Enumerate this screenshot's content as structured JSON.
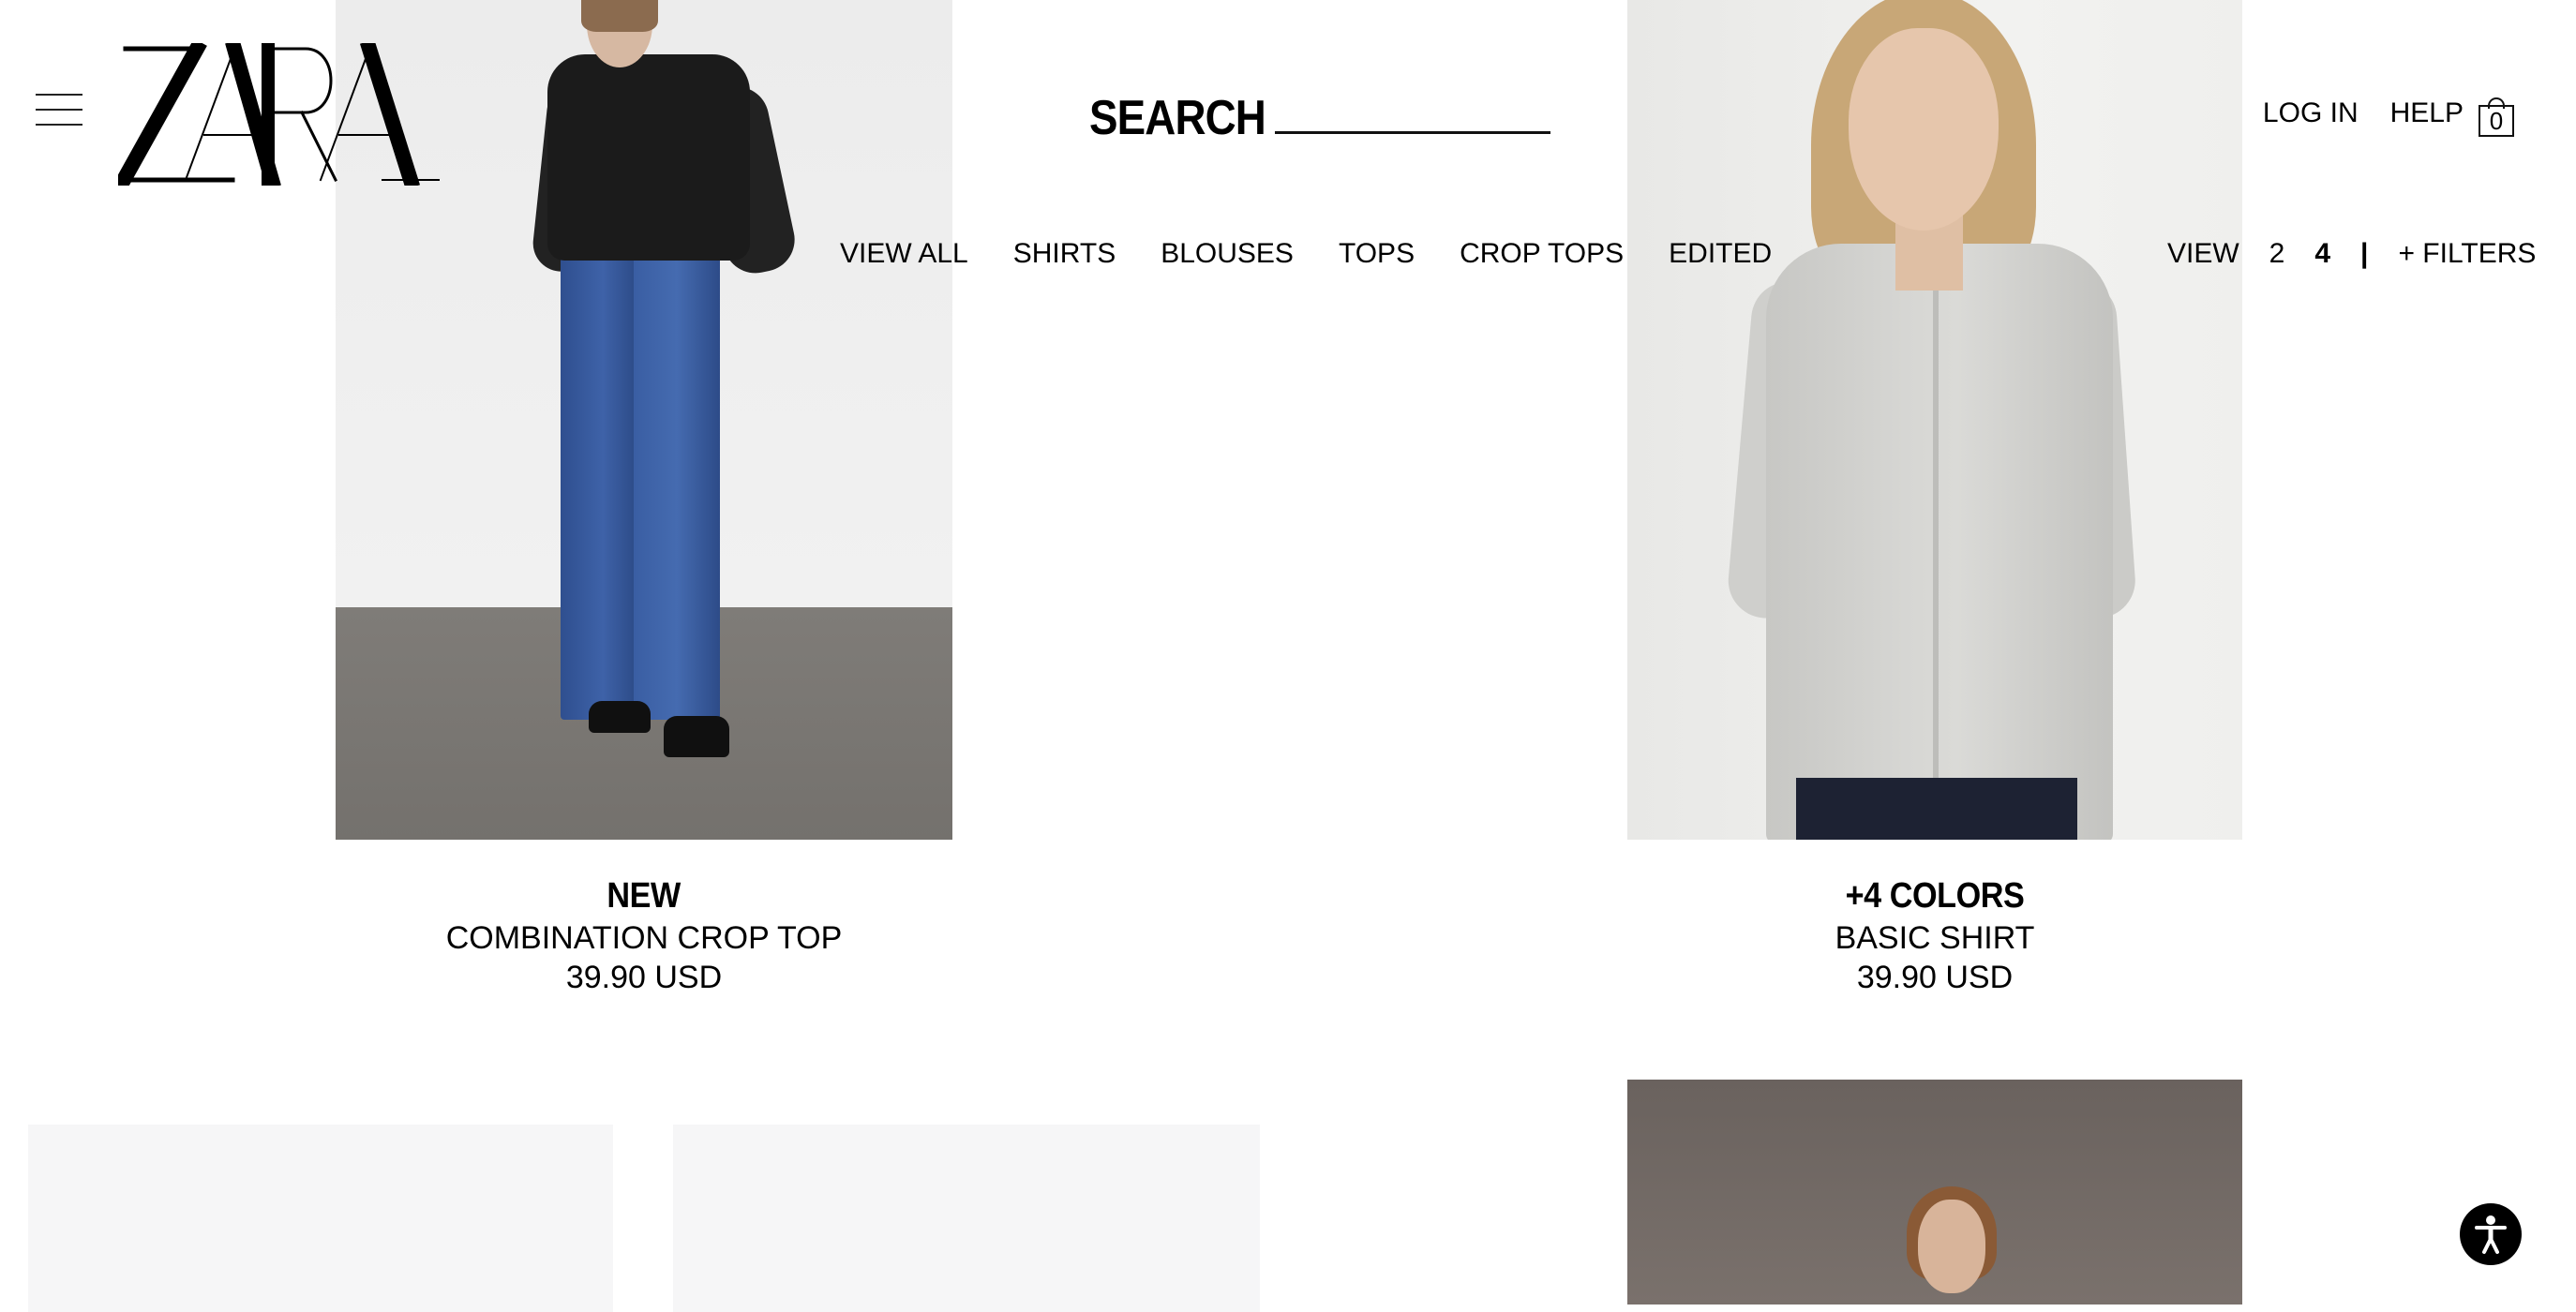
{
  "header": {
    "brand": "ZARA",
    "search_label": "SEARCH",
    "links": {
      "login": "LOG IN",
      "help": "HELP"
    },
    "cart_count": "0"
  },
  "categories": [
    "VIEW ALL",
    "SHIRTS",
    "BLOUSES",
    "TOPS",
    "CROP TOPS",
    "EDITED"
  ],
  "view_controls": {
    "label": "VIEW",
    "options": [
      "2",
      "4"
    ],
    "active": "4",
    "separator": "|",
    "filters": "+ FILTERS"
  },
  "products": [
    {
      "tag": "NEW",
      "name": "COMBINATION CROP TOP",
      "price": "39.90 USD"
    },
    {
      "tag": "+4 COLORS",
      "name": "BASIC SHIRT",
      "price": "39.90 USD"
    }
  ],
  "icons": {
    "menu": "hamburger-icon",
    "cart": "shopping-bag-icon",
    "accessibility": "accessibility-icon"
  },
  "colors": {
    "text": "#000000",
    "background": "#ffffff",
    "placeholder": "#f6f6f7"
  }
}
